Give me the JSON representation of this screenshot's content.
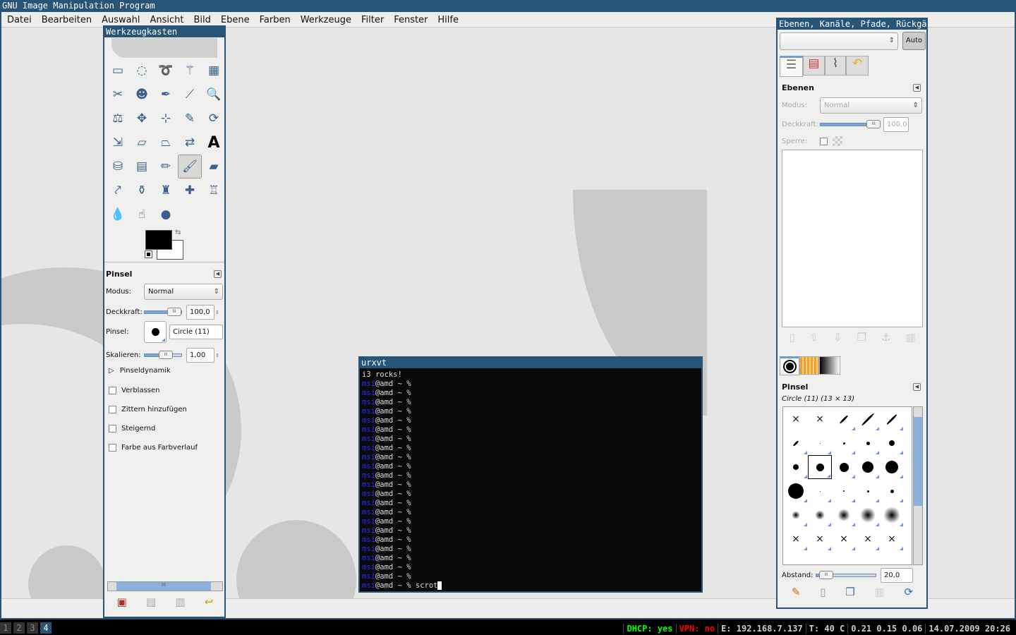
{
  "window": {
    "title": "GNU Image Manipulation Program"
  },
  "menu": [
    "Datei",
    "Bearbeiten",
    "Auswahl",
    "Ansicht",
    "Bild",
    "Ebene",
    "Farben",
    "Werkzeuge",
    "Filter",
    "Fenster",
    "Hilfe"
  ],
  "toolbox": {
    "title": "Werkzeugkasten",
    "tools": [
      {
        "name": "rect-select",
        "glyph": "▭"
      },
      {
        "name": "ellipse-select",
        "glyph": "◌"
      },
      {
        "name": "free-select",
        "glyph": "➰"
      },
      {
        "name": "fuzzy-select",
        "glyph": "⚚"
      },
      {
        "name": "color-select",
        "glyph": "▦"
      },
      {
        "name": "scissors",
        "glyph": "✂"
      },
      {
        "name": "foreground-select",
        "glyph": "☻"
      },
      {
        "name": "paths",
        "glyph": "✒"
      },
      {
        "name": "color-picker",
        "glyph": "⟋"
      },
      {
        "name": "zoom",
        "glyph": "🔍"
      },
      {
        "name": "measure",
        "glyph": "⚖"
      },
      {
        "name": "move",
        "glyph": "✥"
      },
      {
        "name": "align",
        "glyph": "⊹"
      },
      {
        "name": "crop",
        "glyph": "✎"
      },
      {
        "name": "rotate",
        "glyph": "⟳"
      },
      {
        "name": "scale",
        "glyph": "⇲"
      },
      {
        "name": "shear",
        "glyph": "▱"
      },
      {
        "name": "perspective",
        "glyph": "⏢"
      },
      {
        "name": "flip",
        "glyph": "⇄"
      },
      {
        "name": "text",
        "glyph": "A"
      },
      {
        "name": "bucket-fill",
        "glyph": "⛁"
      },
      {
        "name": "blend",
        "glyph": "▤"
      },
      {
        "name": "pencil",
        "glyph": "✏"
      },
      {
        "name": "paintbrush",
        "glyph": "🖌",
        "active": true
      },
      {
        "name": "eraser",
        "glyph": "▰"
      },
      {
        "name": "airbrush",
        "glyph": "⤤"
      },
      {
        "name": "ink",
        "glyph": "⚱"
      },
      {
        "name": "clone",
        "glyph": "♜"
      },
      {
        "name": "heal",
        "glyph": "✚"
      },
      {
        "name": "perspective-clone",
        "glyph": "♖"
      },
      {
        "name": "blur",
        "glyph": "💧"
      },
      {
        "name": "smudge",
        "glyph": "☝"
      },
      {
        "name": "dodge-burn",
        "glyph": "●"
      }
    ],
    "foreground_color": "#000000",
    "background_color": "#ffffff",
    "options": {
      "title": "Pinsel",
      "mode_label": "Modus:",
      "mode_value": "Normal",
      "opacity_label": "Deckkraft:",
      "opacity_value": "100,0",
      "opacity_fraction": 1.0,
      "brush_label": "Pinsel:",
      "brush_value": "Circle (11)",
      "scale_label": "Skalieren:",
      "scale_value": "1,00",
      "scale_fraction": 0.55,
      "dynamics_label": "Pinseldynamik",
      "checkboxes": [
        {
          "label": "Verblassen",
          "checked": false
        },
        {
          "label": "Zittern hinzufügen",
          "checked": false
        },
        {
          "label": "Steigernd",
          "checked": false
        },
        {
          "label": "Farbe aus Farbverlauf",
          "checked": false
        }
      ]
    }
  },
  "terminal": {
    "title": "urxvt",
    "greeting": "i3 rocks!",
    "user": "msi",
    "host_prompt": "@amd ~ % ",
    "prompt_count": 22,
    "last_command": "scrot"
  },
  "dock": {
    "title": "Ebenen, Kanäle, Pfade, Rückgäng",
    "auto_label": "Auto",
    "layers": {
      "title": "Ebenen",
      "mode_label": "Modus:",
      "mode_value": "Normal",
      "opacity_label": "Deckkraft:",
      "opacity_value": "100,0",
      "lock_label": "Sperre:"
    },
    "brushes": {
      "title": "Pinsel",
      "selected": "Circle (11) (13 × 13)",
      "spacing_label": "Abstand:",
      "spacing_value": "20,0"
    }
  },
  "taskbar": {
    "workspaces": [
      "1",
      "2",
      "3",
      "4"
    ],
    "active_workspace": "4",
    "status": [
      {
        "text": "DHCP: yes",
        "color": "#00ff00"
      },
      {
        "text": "VPN: no",
        "color": "#ff0000"
      },
      {
        "text": "E: 192.168.7.137",
        "color": "#cccccc"
      },
      {
        "text": "T: 40 C",
        "color": "#cccccc"
      },
      {
        "text": "0.21 0.15 0.06",
        "color": "#cccccc"
      },
      {
        "text": "14.07.2009 20:26",
        "color": "#cccccc"
      }
    ]
  }
}
